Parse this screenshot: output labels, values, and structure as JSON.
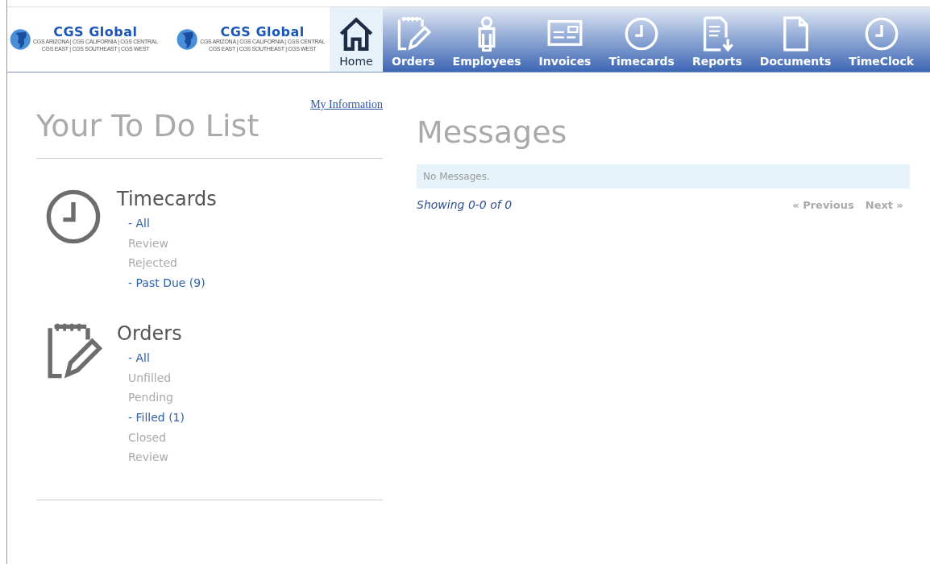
{
  "logos": [
    {
      "name": "CGS Global",
      "line_1": "CGS ARIZONA | CGS CALIFORNIA | CGS CENTRAL",
      "line_2": "CGS EAST | CGS SOUTHEAST | CGS WEST"
    },
    {
      "name": "CGS Global",
      "line_1": "CGS ARIZONA | CGS CALIFORNIA | CGS CENTRAL",
      "line_2": "CGS EAST | CGS SOUTHEAST | CGS WEST"
    }
  ],
  "nav": [
    {
      "label": "Home",
      "kind": "home",
      "selected": true
    },
    {
      "label": "Orders",
      "kind": "orders",
      "selected": false
    },
    {
      "label": "Employees",
      "kind": "employees",
      "selected": false
    },
    {
      "label": "Invoices",
      "kind": "invoices",
      "selected": false
    },
    {
      "label": "Timecards",
      "kind": "clock",
      "selected": false
    },
    {
      "label": "Reports",
      "kind": "reports",
      "selected": false
    },
    {
      "label": "Documents",
      "kind": "documents",
      "selected": false
    },
    {
      "label": "TimeClock",
      "kind": "clock",
      "selected": false
    }
  ],
  "todo": {
    "title": "Your To Do List",
    "link": "My Information",
    "sections": [
      {
        "title": "Timecards",
        "kind": "clock",
        "items": [
          {
            "label": "- All",
            "disabled": false
          },
          {
            "label": "Review",
            "disabled": true
          },
          {
            "label": "Rejected",
            "disabled": true
          },
          {
            "label": "- Past Due (9)",
            "disabled": false
          }
        ]
      },
      {
        "title": "Orders",
        "kind": "orders",
        "items": [
          {
            "label": "- All",
            "disabled": false
          },
          {
            "label": "Unfilled",
            "disabled": true
          },
          {
            "label": "Pending",
            "disabled": true
          },
          {
            "label": "- Filled (1)",
            "disabled": false
          },
          {
            "label": "Closed",
            "disabled": true
          },
          {
            "label": "Review",
            "disabled": true
          }
        ]
      }
    ]
  },
  "messages": {
    "title": "Messages",
    "empty": "No Messages.",
    "showing": "Showing 0-0 of 0",
    "previous": "« Previous",
    "next": "Next »"
  }
}
